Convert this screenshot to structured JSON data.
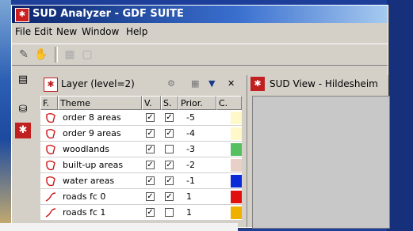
{
  "window": {
    "title": "SUD Analyzer - GDF SUITE"
  },
  "menu": [
    "File",
    "Edit",
    "New",
    "Window",
    "Help"
  ],
  "toolbar": {
    "buttons": [
      "pencil-icon",
      "hand-icon",
      "grid-icon",
      "square-icon"
    ]
  },
  "left_strip": {
    "icons": [
      "window-icon",
      "database-icon",
      "sud-logo-icon"
    ]
  },
  "layer_panel": {
    "title": "Layer (level=2)",
    "columns": [
      "F.",
      "Theme",
      "V.",
      "S.",
      "Prior.",
      "C."
    ],
    "rows": [
      {
        "theme": "order 8 areas",
        "v": "☑",
        "s": "☑",
        "prior": "-5",
        "color": "#fff8c8",
        "type": "area"
      },
      {
        "theme": "order 9 areas",
        "v": "☑",
        "s": "☑",
        "prior": "-4",
        "color": "#fff8c8",
        "type": "area"
      },
      {
        "theme": "woodlands",
        "v": "☑",
        "s": "",
        "prior": "-3",
        "color": "#55c060",
        "type": "area"
      },
      {
        "theme": "built-up areas",
        "v": "☑",
        "s": "☑",
        "prior": "-2",
        "color": "#e8d0c8",
        "type": "area"
      },
      {
        "theme": "water areas",
        "v": "☑",
        "s": "☑",
        "prior": "-1",
        "color": "#0a2ad8",
        "type": "area"
      },
      {
        "theme": "roads fc 0",
        "v": "☑",
        "s": "☑",
        "prior": "1",
        "color": "#e01010",
        "type": "line"
      },
      {
        "theme": "roads fc 1",
        "v": "☑",
        "s": "",
        "prior": "1",
        "color": "#f0b000",
        "type": "line"
      }
    ]
  },
  "view_panel": {
    "title": "SUD View - Hildesheim"
  }
}
